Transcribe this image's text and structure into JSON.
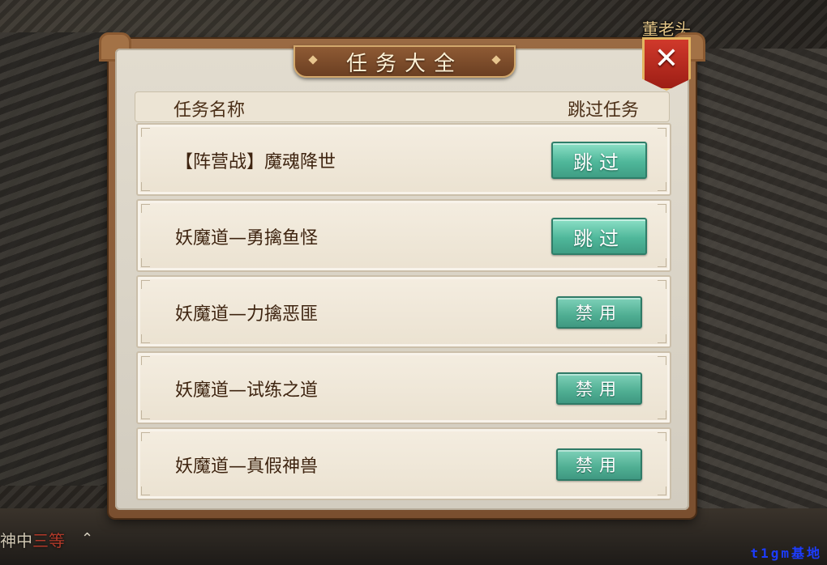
{
  "scene": {
    "npc_name": "董老头",
    "chat_hint_prefix": "神中",
    "chat_hint_highlight": "三等",
    "chat_toggle_glyph": "⌃",
    "watermark": "t1gm基地"
  },
  "dialog": {
    "title": "任务大全",
    "close_glyph": "✕",
    "header": {
      "name_col": "任务名称",
      "skip_col": "跳过任务"
    },
    "tasks": [
      {
        "name": "【阵营战】魔魂降世",
        "button": "跳过",
        "state": "skip"
      },
      {
        "name": "妖魔道—勇擒鱼怪",
        "button": "跳过",
        "state": "skip"
      },
      {
        "name": "妖魔道—力擒恶匪",
        "button": "禁用",
        "state": "disabled"
      },
      {
        "name": "妖魔道—试练之道",
        "button": "禁用",
        "state": "disabled"
      },
      {
        "name": "妖魔道—真假神兽",
        "button": "禁用",
        "state": "disabled"
      }
    ]
  },
  "colors": {
    "frame_brown": "#7a4f2f",
    "parchment": "#ebe2d1",
    "button_green": "#4fb79a",
    "close_red": "#c0342a"
  }
}
